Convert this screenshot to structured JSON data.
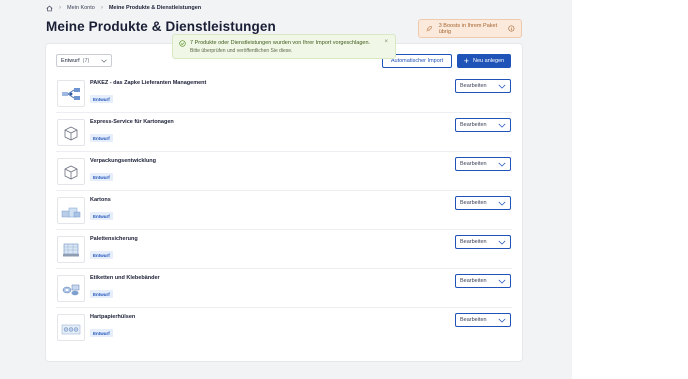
{
  "breadcrumb": {
    "items": [
      "Mein Konto",
      "Meine Produkte & Dienstleistungen"
    ]
  },
  "page": {
    "title": "Meine Produkte & Dienstleistungen"
  },
  "boosts": {
    "text": "3 Boosts in Ihrem Paket übrig"
  },
  "toast": {
    "title": "7 Produkte oder Dienstleistungen wurden von Ihrer Import vorgeschlagen.",
    "subtitle": "Bitte überprüfen und veröffentlichen Sie diese.",
    "close": "×"
  },
  "toolbar": {
    "filter_value": "Entwurf",
    "filter_count": "(7)",
    "import_label": "Automatischer Import",
    "new_label": "Neu anlegen"
  },
  "products": [
    {
      "title": "PAKEZ - das Zapke Lieferanten Management",
      "status": "Entwurf",
      "action": "Bearbeiten",
      "thumb": "network-diagram"
    },
    {
      "title": "Express-Service für Kartonagen",
      "status": "Entwurf",
      "action": "Bearbeiten",
      "thumb": "box-icon"
    },
    {
      "title": "Verpackungsentwicklung",
      "status": "Entwurf",
      "action": "Bearbeiten",
      "thumb": "box-icon"
    },
    {
      "title": "Kartons",
      "status": "Entwurf",
      "action": "Bearbeiten",
      "thumb": "cartons-image"
    },
    {
      "title": "Palettensicherung",
      "status": "Entwurf",
      "action": "Bearbeiten",
      "thumb": "pallet-image"
    },
    {
      "title": "Etiketten und Klebebänder",
      "status": "Entwurf",
      "action": "Bearbeiten",
      "thumb": "tapes-image"
    },
    {
      "title": "Hartpapierhülsen",
      "status": "Entwurf",
      "action": "Bearbeiten",
      "thumb": "tubes-image"
    }
  ],
  "colors": {
    "primary": "#1f53b8",
    "background": "#f2f3f5",
    "boost_bg": "#fbe9dc",
    "toast_bg": "#f0f7e6"
  }
}
